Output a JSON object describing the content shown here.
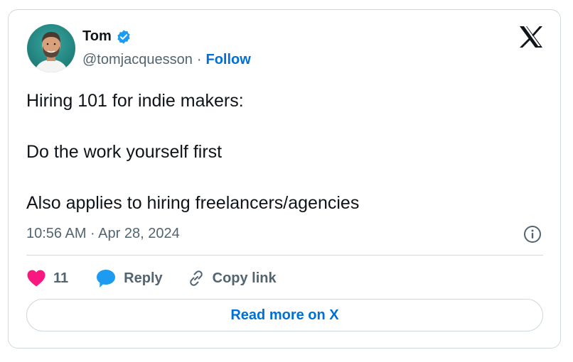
{
  "author": {
    "name": "Tom",
    "handle": "@tomjacquesson",
    "separator": "·",
    "follow_label": "Follow",
    "verified": true
  },
  "tweet": {
    "lines": [
      "Hiring 101 for indie makers:",
      "Do the work yourself first",
      "Also applies to hiring freelancers/agencies"
    ],
    "timestamp": "10:56 AM · Apr 28, 2024"
  },
  "actions": {
    "like_count": "11",
    "reply_label": "Reply",
    "copy_link_label": "Copy link"
  },
  "read_more_label": "Read more on X",
  "icons": {
    "verified": "verified-badge-icon",
    "platform": "x-logo-icon",
    "info": "info-icon",
    "like": "heart-icon",
    "reply": "reply-bubble-icon",
    "copy": "link-icon"
  },
  "colors": {
    "accent": "#006fd6",
    "heart": "#f91880",
    "reply_bubble": "#1d9bf0",
    "verified": "#1d9bf0",
    "text": "#0f1419",
    "muted": "#536471",
    "border": "#cfd9de"
  }
}
